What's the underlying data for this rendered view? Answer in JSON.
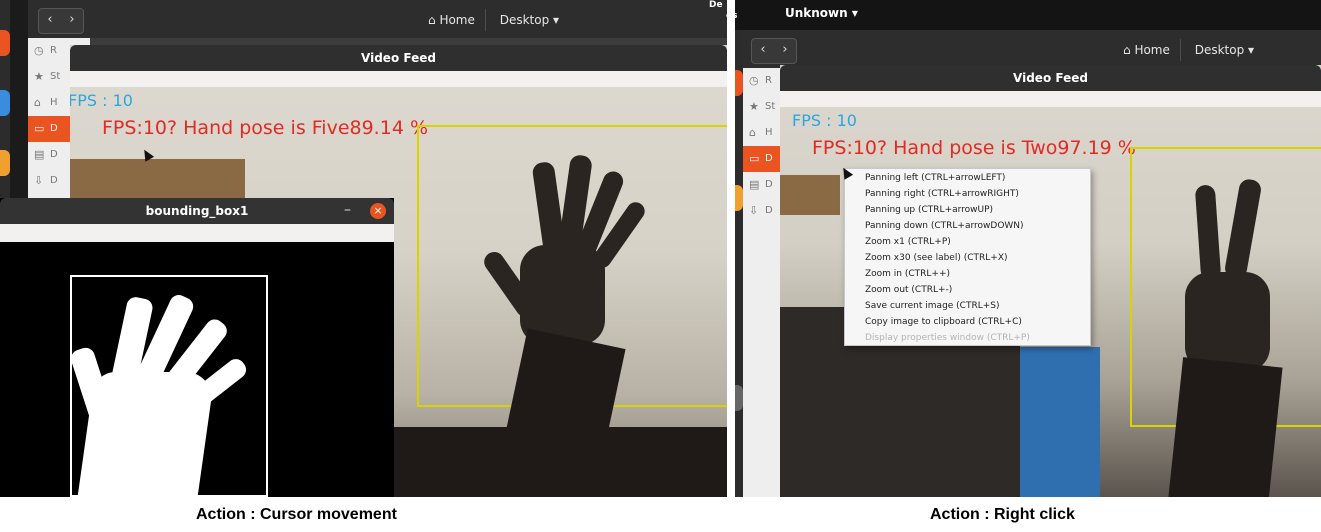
{
  "left": {
    "file_manager": {
      "back_icon": "chevron-left-icon",
      "forward_icon": "chevron-right-icon",
      "home_label": "Home",
      "desktop_label": "Desktop",
      "sidebar_fragments": [
        "R",
        "St",
        "H",
        "D",
        "D",
        "D"
      ]
    },
    "video_window": {
      "title": "Video Feed",
      "fps_text": "FPS : 10",
      "pose_text": "FPS:10? Hand pose is Five89.14 %"
    },
    "bbox_window": {
      "title": "bounding_box1",
      "minimize": "–",
      "close": "×"
    },
    "caption": "Action : Cursor movement"
  },
  "right": {
    "top_fragment_left": "es",
    "top_fragment_right": "De",
    "unknown_menu": "Unknown ▾",
    "file_manager": {
      "home_label": "Home",
      "desktop_label": "Desktop",
      "sidebar_fragments": [
        "R",
        "St",
        "H",
        "D",
        "D",
        "D"
      ]
    },
    "video_window": {
      "title": "Video Feed",
      "fps_text": "FPS : 10",
      "pose_text": "FPS:10? Hand pose is Two97.19 %"
    },
    "context_menu": {
      "items": [
        "Panning left (CTRL+arrowLEFT)",
        "Panning right (CTRL+arrowRIGHT)",
        "Panning up (CTRL+arrowUP)",
        "Panning down (CTRL+arrowDOWN)",
        "Zoom x1 (CTRL+P)",
        "Zoom x30 (see label) (CTRL+X)",
        "Zoom in (CTRL++)",
        "Zoom out (CTRL+-)",
        "Save current image (CTRL+S)",
        "Copy image to clipboard (CTRL+C)"
      ],
      "disabled_item": "Display properties window (CTRL+P)"
    },
    "caption": "Action : Right click"
  },
  "colors": {
    "fps_blue": "#2aa7e0",
    "pose_red": "#e02b25",
    "box_yellow": "#d9d400",
    "ubuntu_orange": "#e95420"
  }
}
